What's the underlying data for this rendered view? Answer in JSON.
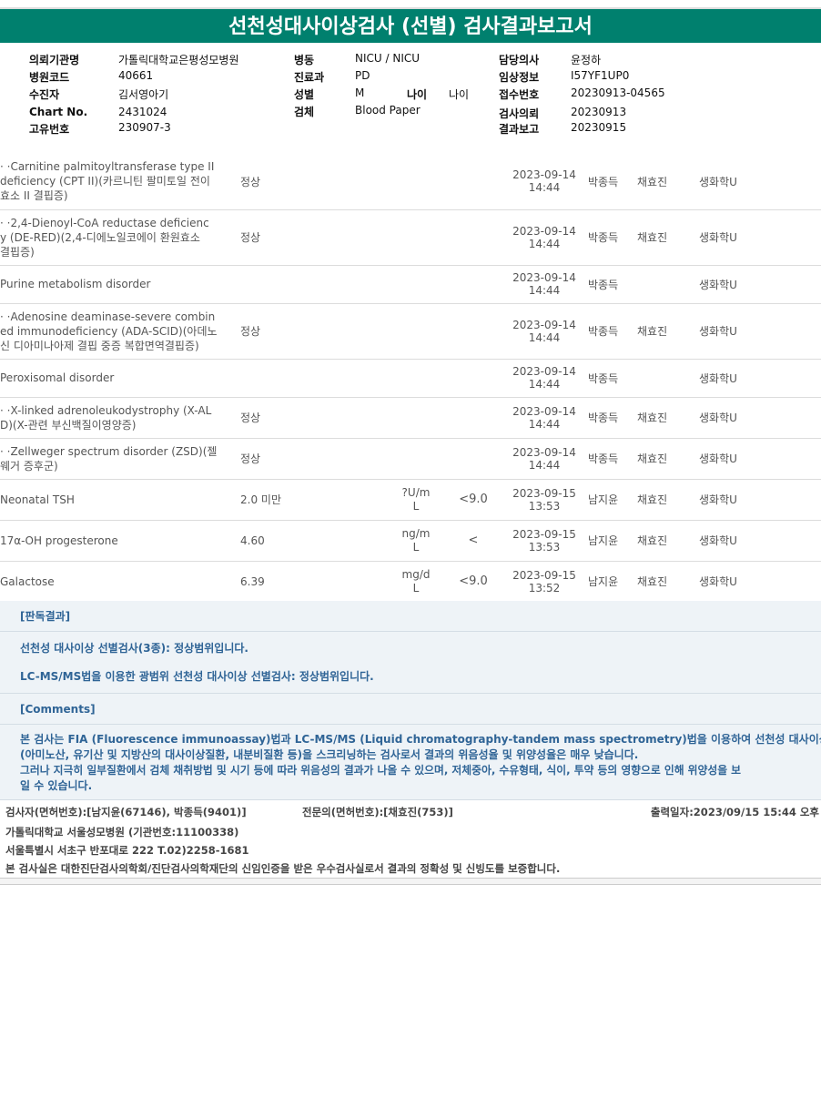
{
  "report_title": "선천성대사이상검사 (선별) 검사결과보고서",
  "header": {
    "left": [
      {
        "label": "의뢰기관명",
        "value": "가톨릭대학교은평성모병원"
      },
      {
        "label": "병원코드",
        "value": "40661"
      },
      {
        "label": "수진자",
        "value": "김서영아기"
      },
      {
        "label": "Chart No.",
        "value": "2431024"
      },
      {
        "label": "고유번호",
        "value": "230907-3"
      }
    ],
    "mid": [
      {
        "label": "병동",
        "value": "NICU / NICU"
      },
      {
        "label": "진료과",
        "value": "PD"
      },
      {
        "label": "성별",
        "value": "M"
      },
      {
        "label": "검체",
        "value": "Blood Paper"
      }
    ],
    "age_label": "나이",
    "age_value": "나이",
    "right": [
      {
        "label": "담당의사",
        "value": "윤정하"
      },
      {
        "label": "임상정보",
        "value": "I57YF1UP0"
      },
      {
        "label": "접수번호",
        "value": "20230913-04565"
      },
      {
        "label": "검사의뢰",
        "value": "20230913"
      },
      {
        "label": "결과보고",
        "value": "20230915"
      }
    ]
  },
  "results": [
    {
      "name": "  · ·Carnitine palmitoyltransferase type II\ndeficiency (CPT II)(카르니틴 팔미토일 전이\n효소 II 결핍증)",
      "result": "정상",
      "unit": "",
      "ref": "",
      "date": "2023-09-14",
      "time": "14:44",
      "p1": "박종득",
      "p2": "채효진",
      "dept": "생화학U"
    },
    {
      "name": "  · ·2,4-Dienoyl-CoA reductase deficienc\ny (DE-RED)(2,4-디에노일코에이 환원효소\n결핍증)",
      "result": "정상",
      "unit": "",
      "ref": "",
      "date": "2023-09-14",
      "time": "14:44",
      "p1": "박종득",
      "p2": "채효진",
      "dept": "생화학U"
    },
    {
      "name": "  Purine metabolism disorder",
      "result": "",
      "unit": "",
      "ref": "",
      "date": "2023-09-14",
      "time": "14:44",
      "p1": "박종득",
      "p2": "",
      "dept": "생화학U"
    },
    {
      "name": "  · ·Adenosine deaminase-severe combin\ned immunodeficiency (ADA-SCID)(아데노\n신 디아미나아제 결핍 중증 복합면역결핍증)",
      "result": "정상",
      "unit": "",
      "ref": "",
      "date": "2023-09-14",
      "time": "14:44",
      "p1": "박종득",
      "p2": "채효진",
      "dept": "생화학U"
    },
    {
      "name": "  Peroxisomal disorder",
      "result": "",
      "unit": "",
      "ref": "",
      "date": "2023-09-14",
      "time": "14:44",
      "p1": "박종득",
      "p2": "",
      "dept": "생화학U"
    },
    {
      "name": "  · ·X-linked adrenoleukodystrophy (X-AL\nD)(X-관련 부신백질이영양증)",
      "result": "정상",
      "unit": "",
      "ref": "",
      "date": "2023-09-14",
      "time": "14:44",
      "p1": "박종득",
      "p2": "채효진",
      "dept": "생화학U"
    },
    {
      "name": "  · ·Zellweger spectrum disorder (ZSD)(젤\n웨거 증후군)",
      "result": "정상",
      "unit": "",
      "ref": "",
      "date": "2023-09-14",
      "time": "14:44",
      "p1": "박종득",
      "p2": "채효진",
      "dept": "생화학U"
    },
    {
      "name": "  Neonatal TSH",
      "result": "2.0 미만",
      "unit": "?U/m\nL",
      "ref": "<9.0",
      "date": "2023-09-15",
      "time": "13:53",
      "p1": "남지윤",
      "p2": "채효진",
      "dept": "생화학U"
    },
    {
      "name": "  17α-OH progesterone",
      "result": "4.60",
      "unit": "ng/m\nL",
      "ref": "<",
      "date": "2023-09-15",
      "time": "13:53",
      "p1": "남지윤",
      "p2": "채효진",
      "dept": "생화학U"
    },
    {
      "name": "  Galactose",
      "result": "6.39",
      "unit": "mg/d\nL",
      "ref": "<9.0",
      "date": "2023-09-15",
      "time": "13:52",
      "p1": "남지윤",
      "p2": "채효진",
      "dept": "생화학U"
    }
  ],
  "notes": {
    "judgement_header": "[판독결과]",
    "judgement_1": "선천성 대사이상 선별검사(3종): 정상범위입니다.",
    "judgement_2": "LC-MS/MS법을 이용한 광범위 선천성 대사이상 선별검사: 정상범위입니다.",
    "comments_header": "[Comments]",
    "comment_1": "본 검사는 FIA (Fluorescence immunoassay)법과 LC-MS/MS (Liquid chromatography-tandem mass spectrometry)법을 이용하여 선천성 대사이상질환",
    "comment_2": "(아미노산, 유기산 및 지방산의 대사이상질환, 내분비질환 등)을 스크리닝하는 검사로서 결과의 위음성율 및 위양성율은 매우 낮습니다.",
    "comment_3": "그러나 지극히 일부질환에서 검체 채취방법 및 시기 등에 따라 위음성의 결과가 나올 수 있으며, 저체중아, 수유형태, 식이, 투약 등의 영향으로 인해 위양성을 보",
    "comment_4": "일 수 있습니다."
  },
  "footer": {
    "examiner": "검사자(면허번호):[남지윤(67146), 박종득(9401)]",
    "specialist": "전문의(면허번호):[채효진(753)]",
    "print_date": "출력일자:2023/09/15 15:44 오후",
    "hospital": "가톨릭대학교 서울성모병원 (기관번호:11100338)",
    "address": "서울특별시 서초구 반포대로 222 T.02)2258-1681",
    "certification": "본 검사실은 대한진단검사의학회/진단검사의학재단의 신임인증을 받은 우수검사실로서 결과의 정확성 및 신빙도를 보증합니다."
  }
}
